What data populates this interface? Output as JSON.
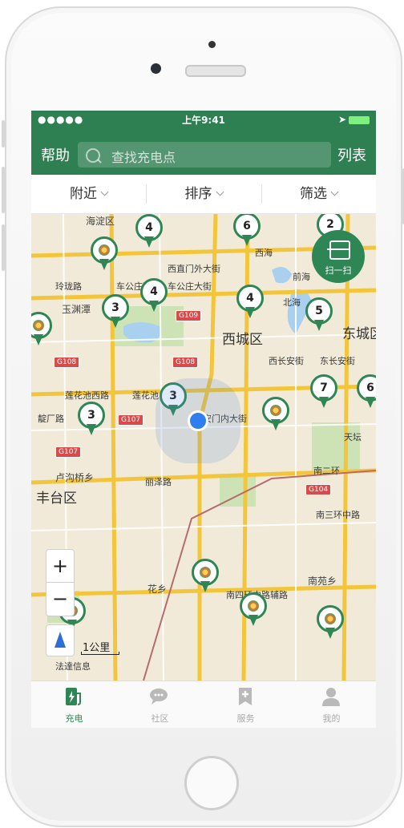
{
  "status_bar": {
    "signal": "●●●●● ",
    "time": "上午9:41",
    "location_glyph": "➤"
  },
  "nav": {
    "help": "帮助",
    "search_placeholder": "查找充电点",
    "list": "列表"
  },
  "filters": {
    "nearby": "附近",
    "sort": "排序",
    "filter": "筛选"
  },
  "map": {
    "scan_label": "扫一扫",
    "zoom_in": "+",
    "zoom_out": "−",
    "scale": "1公里",
    "labels": {
      "haidian": "海淀区",
      "xicheng": "西城区",
      "dongcheng": "东城区",
      "fengtai": "丰台区",
      "xizhimenwai": "西直门外大街",
      "chegongzhuang": "车公庄大街",
      "chegongzhuang_w": "车公庄西",
      "linglong": "玲珑路",
      "yuyuantan": "玉渊潭",
      "lianhuachi_w": "莲花池西路",
      "lianhuachi": "莲花池",
      "xian": "西长安街",
      "dongchanganjie": "东长安街",
      "anmen": "安门内大街",
      "lizeroad": "丽泽路",
      "lugouqiao": "卢沟桥乡",
      "huaxiang": "花乡",
      "nanyuanxiang": "南苑乡",
      "nansi": "南四环中路辅路",
      "nansanhuan": "南三环中路",
      "nanerhuan": "南二环",
      "tiantan": "天坛",
      "xihai": "西海",
      "qianhai": "前海",
      "beihai": "北海",
      "dingfang": "靛厂路",
      "fatai": "法達信息"
    },
    "shields": {
      "g109": "G109",
      "g108a": "G108",
      "g108b": "G108",
      "g107a": "G107",
      "g107b": "G107",
      "g104": "G104"
    },
    "clusters": [
      "4",
      "6",
      "2",
      "4",
      "3",
      "4",
      "5",
      "3",
      "3",
      "7",
      "6"
    ]
  },
  "tabs": [
    {
      "label": "充电",
      "icon": "charging-pile-icon",
      "active": true
    },
    {
      "label": "社区",
      "icon": "chat-bubble-icon",
      "active": false
    },
    {
      "label": "服务",
      "icon": "bookmark-plus-icon",
      "active": false
    },
    {
      "label": "我的",
      "icon": "user-icon",
      "active": false
    }
  ],
  "colors": {
    "brand_green": "#2e7f52",
    "pin_green": "#2f8655",
    "location_blue": "#2f7ef0"
  }
}
